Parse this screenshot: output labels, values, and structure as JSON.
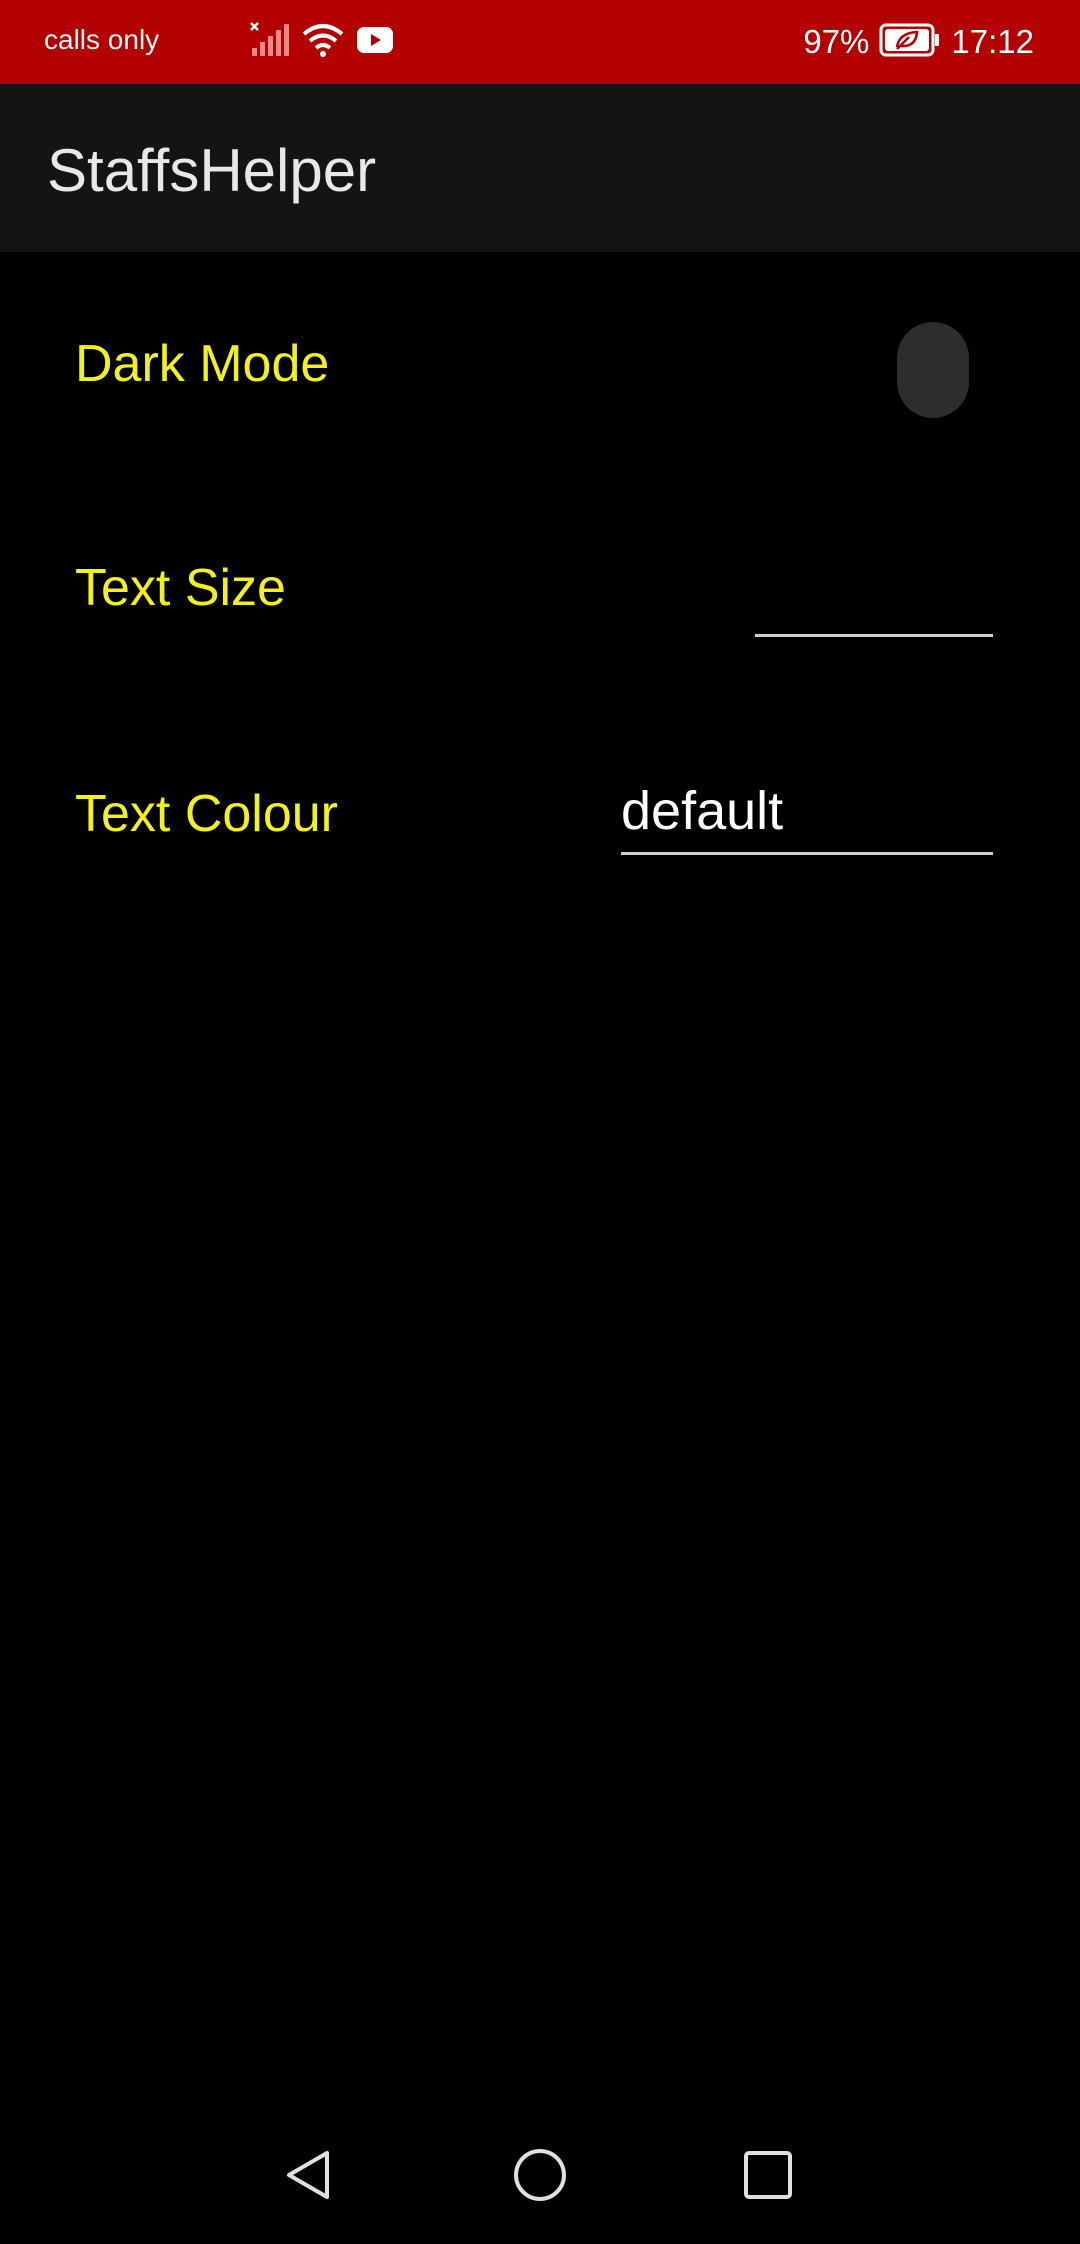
{
  "status_bar": {
    "carrier_text": "calls only",
    "battery_percent": "97%",
    "time": "17:12",
    "background_color": "#b30000",
    "icons": [
      "signal-off-icon",
      "wifi-icon",
      "youtube-icon",
      "battery-saver-icon"
    ]
  },
  "app_bar": {
    "title": "StaffsHelper"
  },
  "settings": {
    "dark_mode": {
      "label": "Dark Mode",
      "enabled": false
    },
    "text_size": {
      "label": "Text Size",
      "value": ""
    },
    "text_colour": {
      "label": "Text Colour",
      "value": "default"
    },
    "label_color": "#f2f21a"
  },
  "nav_bar": {
    "icons": [
      "back-icon",
      "home-icon",
      "recents-icon"
    ]
  }
}
